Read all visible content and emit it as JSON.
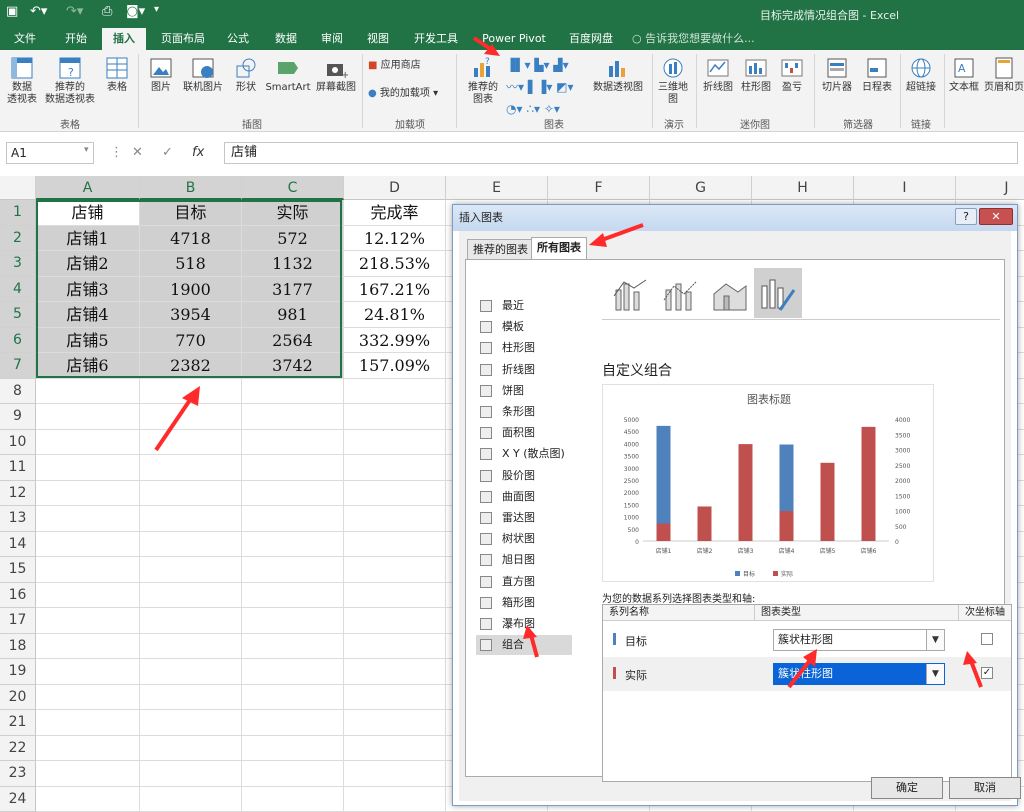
{
  "window": {
    "title": "目标完成情况组合图 - Excel"
  },
  "tabs": [
    {
      "label": "文件",
      "active": false
    },
    {
      "label": "开始",
      "active": false
    },
    {
      "label": "插入",
      "active": true
    },
    {
      "label": "页面布局",
      "active": false
    },
    {
      "label": "公式",
      "active": false
    },
    {
      "label": "数据",
      "active": false
    },
    {
      "label": "审阅",
      "active": false
    },
    {
      "label": "视图",
      "active": false
    },
    {
      "label": "开发工具",
      "active": false
    },
    {
      "label": "Power Pivot",
      "active": false
    },
    {
      "label": "百度网盘",
      "active": false
    }
  ],
  "tell_me": "告诉我您想要做什么...",
  "ribbon": {
    "pivot": "数据\n透视表",
    "rec_pivot": "推荐的\n数据透视表",
    "table": "表格",
    "group_tables": "表格",
    "picture": "图片",
    "online_picture": "联机图片",
    "shapes": "形状",
    "smartart": "SmartArt",
    "screenshot": "屏幕截图",
    "group_illustrations": "插图",
    "store": "应用商店",
    "my_addins": "我的加载项",
    "group_addins": "加载项",
    "rec_charts": "推荐的\n图表",
    "pivot_chart": "数据透视图",
    "group_charts": "图表",
    "map3d": "三维地\n图",
    "group_tours": "演示",
    "spark_line": "折线图",
    "spark_col": "柱形图",
    "spark_wl": "盈亏",
    "group_spark": "迷你图",
    "slicer": "切片器",
    "timeline": "日程表",
    "group_filter": "筛选器",
    "hyperlink": "超链接",
    "group_links": "链接",
    "textbox": "文本框",
    "header": "页眉和页"
  },
  "formula_bar": {
    "name_box": "A1",
    "content": "店铺"
  },
  "columns": [
    "A",
    "B",
    "C",
    "D",
    "E",
    "F",
    "G",
    "H",
    "I",
    "J"
  ],
  "rows": [
    "1",
    "2",
    "3",
    "4",
    "5",
    "6",
    "7",
    "8",
    "9",
    "10",
    "11",
    "12",
    "13",
    "14",
    "15",
    "16",
    "17",
    "18",
    "19",
    "20",
    "21",
    "22",
    "23",
    "24"
  ],
  "table": {
    "headers": [
      "店铺",
      "目标",
      "实际",
      "完成率"
    ],
    "rows": [
      [
        "店铺1",
        "4718",
        "572",
        "12.12%"
      ],
      [
        "店铺2",
        "518",
        "1132",
        "218.53%"
      ],
      [
        "店铺3",
        "1900",
        "3177",
        "167.21%"
      ],
      [
        "店铺4",
        "3954",
        "981",
        "24.81%"
      ],
      [
        "店铺5",
        "770",
        "2564",
        "332.99%"
      ],
      [
        "店铺6",
        "2382",
        "3742",
        "157.09%"
      ]
    ]
  },
  "dialog": {
    "title": "插入图表",
    "help": "?",
    "close": "✕",
    "tabs": [
      "推荐的图表",
      "所有图表"
    ],
    "chart_types": [
      "最近",
      "模板",
      "柱形图",
      "折线图",
      "饼图",
      "条形图",
      "面积图",
      "X Y (散点图)",
      "股价图",
      "曲面图",
      "雷达图",
      "树状图",
      "旭日图",
      "直方图",
      "箱形图",
      "瀑布图",
      "组合"
    ],
    "selected_type": "组合",
    "section_title": "自定义组合",
    "series_prompt": "为您的数据系列选择图表类型和轴:",
    "grid_headers": [
      "系列名称",
      "图表类型",
      "次坐标轴"
    ],
    "series": [
      {
        "name": "目标",
        "type": "簇状柱形图",
        "secondary": false,
        "color": "#4f81bd"
      },
      {
        "name": "实际",
        "type": "簇状柱形图",
        "secondary": true,
        "color": "#c0504d"
      }
    ],
    "ok": "确定",
    "cancel": "取消"
  },
  "chart_data": {
    "type": "bar",
    "title": "图表标题",
    "categories": [
      "店铺1",
      "店铺2",
      "店铺3",
      "店铺4",
      "店铺5",
      "店铺6"
    ],
    "series": [
      {
        "name": "目标",
        "axis": "primary",
        "color": "#4f81bd",
        "values": [
          4718,
          518,
          1900,
          3954,
          770,
          2382
        ]
      },
      {
        "name": "实际",
        "axis": "secondary",
        "color": "#c0504d",
        "values": [
          572,
          1132,
          3177,
          981,
          2564,
          3742
        ]
      }
    ],
    "ylim": [
      0,
      5000
    ],
    "y_ticks": [
      0,
      500,
      1000,
      1500,
      2000,
      2500,
      3000,
      3500,
      4000,
      4500,
      5000
    ],
    "y2lim": [
      0,
      4000
    ],
    "y2_ticks": [
      0,
      500,
      1000,
      1500,
      2000,
      2500,
      3000,
      3500,
      4000
    ],
    "legend": "bottom",
    "grid": false
  }
}
